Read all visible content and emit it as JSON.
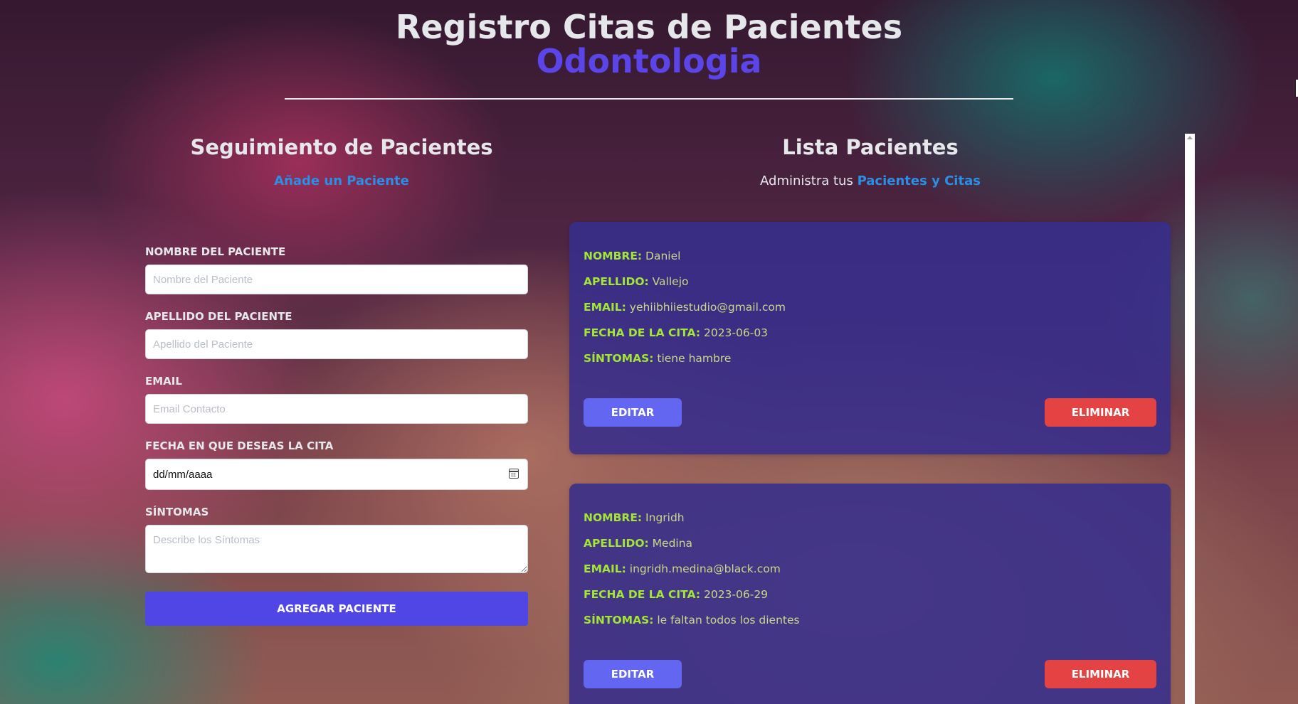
{
  "header": {
    "title": "Registro Citas de Pacientes",
    "subtitle": "Odontologia"
  },
  "form_section": {
    "title": "Seguimiento de Pacientes",
    "sub_prefix": "",
    "sub_link": "Añade un Paciente",
    "fields": {
      "nombre_label": "NOMBRE DEL PACIENTE",
      "nombre_placeholder": "Nombre del Paciente",
      "apellido_label": "APELLIDO DEL PACIENTE",
      "apellido_placeholder": "Apellido del Paciente",
      "email_label": "EMAIL",
      "email_placeholder": "Email Contacto",
      "fecha_label": "FECHA EN QUE DESEAS LA CITA",
      "fecha_value": "dd/mm/aaaa",
      "sintomas_label": "SÍNTOMAS",
      "sintomas_placeholder": "Describe los Síntomas"
    },
    "submit_label": "AGREGAR PACIENTE"
  },
  "list_section": {
    "title": "Lista Pacientes",
    "sub_prefix": "Administra tus ",
    "sub_link": "Pacientes y Citas"
  },
  "labels": {
    "nombre": "NOMBRE:",
    "apellido": "APELLIDO:",
    "email": "EMAIL:",
    "fecha": "FECHA DE LA CITA:",
    "sintomas": "SÍNTOMAS:",
    "edit": "EDITAR",
    "delete": "ELIMINAR"
  },
  "patients": [
    {
      "nombre": "Daniel",
      "apellido": "Vallejo",
      "email": "yehiibhiiestudio@gmail.com",
      "fecha": "2023-06-03",
      "sintomas": "tiene hambre"
    },
    {
      "nombre": "Ingridh",
      "apellido": "Medina",
      "email": "ingridh.medina@black.com",
      "fecha": "2023-06-29",
      "sintomas": "le faltan todos los dientes"
    }
  ],
  "colors": {
    "accent_blue": "#2b8fe6",
    "indigo": "#4f46e5",
    "card_bg": "#372d8c",
    "label_green": "#a3e635",
    "delete_red": "#e34343"
  }
}
